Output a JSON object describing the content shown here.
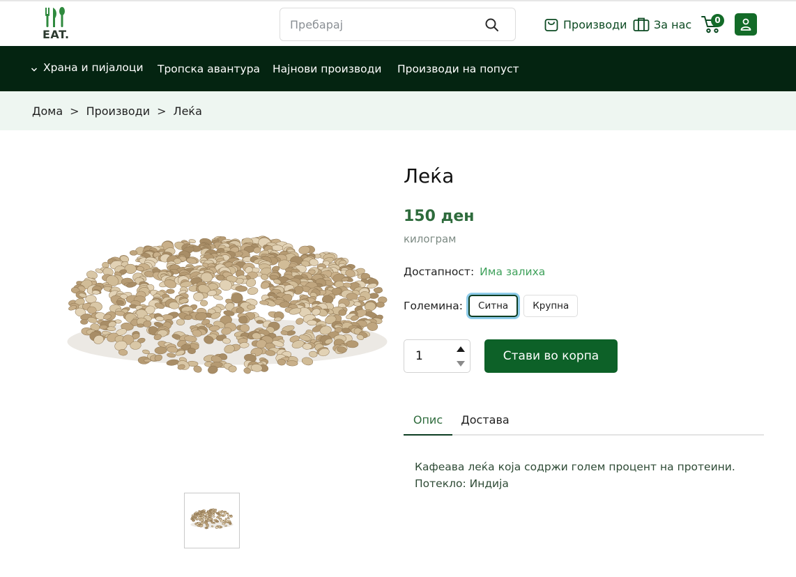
{
  "brand": {
    "logo_text": "EAT."
  },
  "header": {
    "search_placeholder": "Пребарај",
    "products_label": "Производи",
    "about_label": "За нас",
    "cart_count": "0"
  },
  "main_nav": {
    "items": [
      {
        "label": "Храна и пијалоци"
      },
      {
        "label": "Тропска авантура"
      },
      {
        "label": "Најнови производи"
      },
      {
        "label": "Производи на попуст"
      }
    ]
  },
  "breadcrumb": {
    "items": [
      "Дома",
      "Производи",
      "Леќа"
    ],
    "separator": ">"
  },
  "product": {
    "title": "Леќа",
    "price": "150 ден",
    "unit": "килограм",
    "availability_label": "Достапност:",
    "availability_value": "Има залиха",
    "size_label": "Големина:",
    "sizes": [
      {
        "label": "Ситна",
        "selected": true
      },
      {
        "label": "Крупна",
        "selected": false
      }
    ],
    "quantity": "1",
    "add_to_cart_label": "Стави во корпа",
    "image_icon": "lentils-pile-image"
  },
  "tabs": {
    "items": [
      {
        "label": "Опис",
        "active": true
      },
      {
        "label": "Достава",
        "active": false
      }
    ],
    "description_lines": [
      "Кафеава леќа која содржи голем процент на протеини.",
      "Потекло: Индија"
    ]
  },
  "colors": {
    "brand_green": "#0d6128",
    "nav_bg": "#042411",
    "breadcrumb_bg": "#eef6f1",
    "price_green": "#2e6b3c",
    "instock_green": "#3fa15b"
  }
}
